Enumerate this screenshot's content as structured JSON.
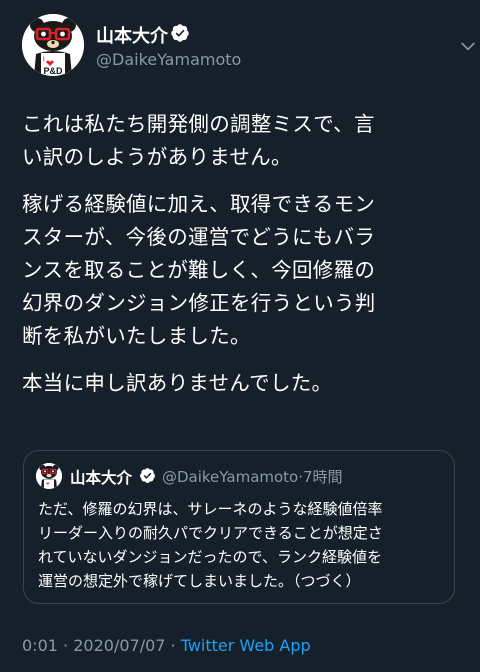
{
  "author": {
    "display_name": "山本大介",
    "handle": "@DaikeYamamoto",
    "avatar_shirt_text": "P&D",
    "avatar_shirt_top": "I"
  },
  "tweet": {
    "paragraphs": [
      "これは私たち開発側の調整ミスで、言\nい訳のしようがありません。",
      "稼げる経験値に加え、取得できるモン\nスターが、今後の運営でどうにもバラ\nンスを取ることが難しく、今回修羅の\n幻界のダンジョン修正を行うという判\n断を私がいたしました。",
      "本当に申し訳ありませんでした。"
    ]
  },
  "quoted_tweet": {
    "display_name": "山本大介",
    "handle": "@DaikeYamamoto",
    "separator": "·",
    "time_ago": "7時間",
    "text": "ただ、修羅の幻界は、サレーネのような経験値倍率\nリーダー入りの耐久パでクリアできることが想定さ\nれていないダンジョンだったので、ランク経験値を\n運営の想定外で稼げてしまいました。（つづく）"
  },
  "footer": {
    "time": "0:01",
    "separator": "·",
    "date": "2020/07/07",
    "source": "Twitter Web App"
  },
  "colors": {
    "background": "#15202b",
    "secondary_text": "#8899a6",
    "accent": "#1da1f2",
    "border": "#38444d"
  }
}
